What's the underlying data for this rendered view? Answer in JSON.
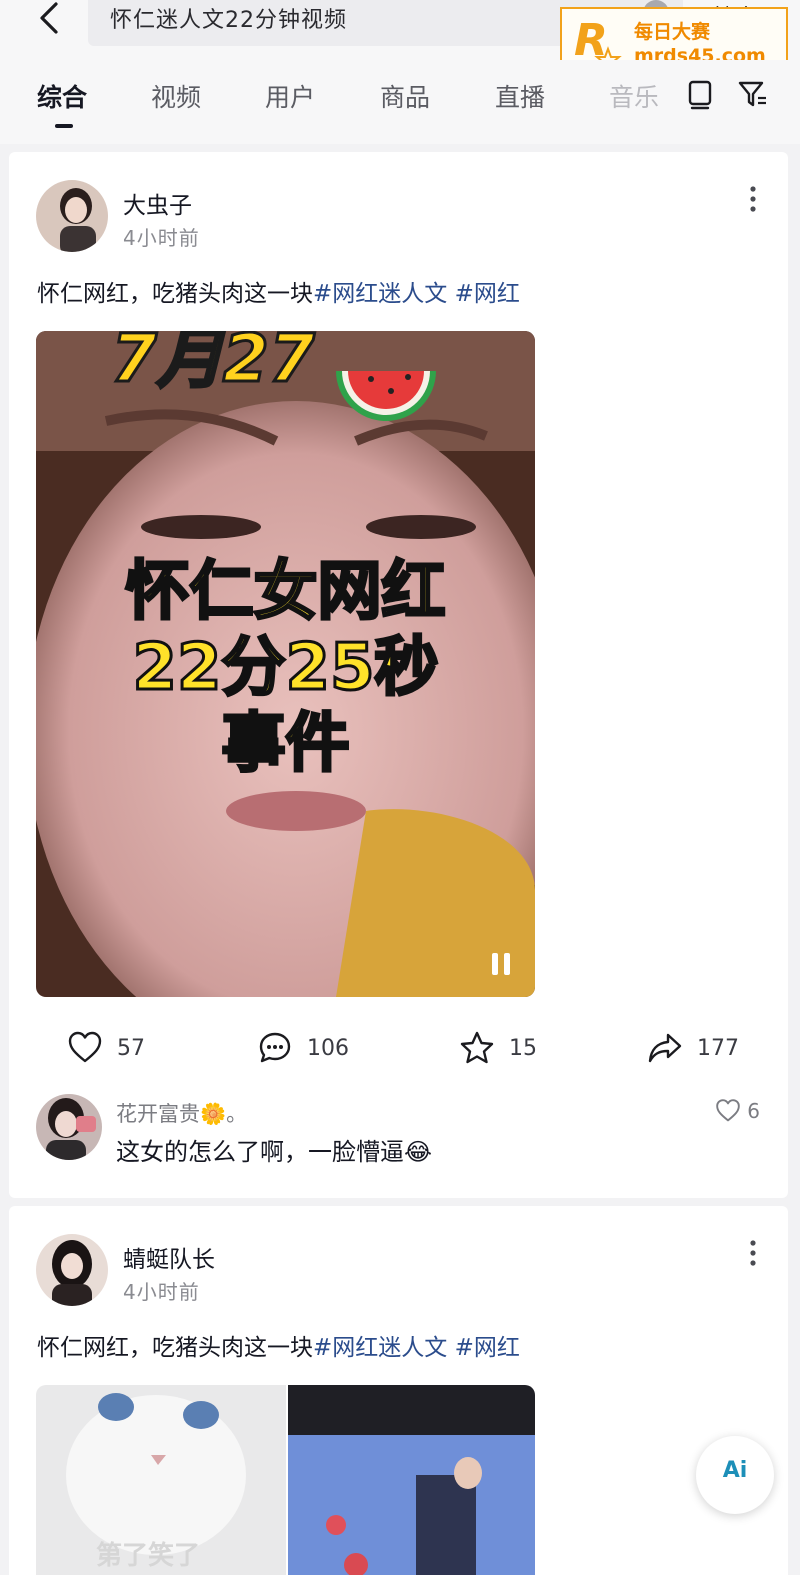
{
  "search": {
    "query": "怀仁迷人文22分钟视频",
    "clear_icon": "close-circle-icon",
    "submit_label": "搜索"
  },
  "watermark": {
    "title": "每日大赛",
    "url": "mrds45.com",
    "color": "#f08a00"
  },
  "tabs": [
    {
      "label": "综合",
      "active": true
    },
    {
      "label": "视频",
      "active": false
    },
    {
      "label": "用户",
      "active": false
    },
    {
      "label": "商品",
      "active": false
    },
    {
      "label": "直播",
      "active": false
    },
    {
      "label": "音乐",
      "active": false
    }
  ],
  "posts": [
    {
      "author": "大虫子",
      "time": "4小时前",
      "caption_text": "怀仁网红，吃猪头肉这一块",
      "tags": [
        "#网红迷人文",
        "#网红"
      ],
      "video": {
        "date_overlay": "7月27",
        "title_lines": [
          "怀仁女网红",
          "22分25秒",
          "事件"
        ]
      },
      "stats": {
        "likes": "57",
        "comments": "106",
        "favorites": "15",
        "shares": "177"
      },
      "top_comment": {
        "user": "花开富贵🌼。",
        "text": "这女的怎么了啊，一脸懵逼😂",
        "likes": "6"
      }
    },
    {
      "author": "蜻蜓队长",
      "time": "4小时前",
      "caption_text": "怀仁网红，吃猪头肉这一块",
      "tags": [
        "#网红迷人文",
        "#网红"
      ],
      "thumb_text": "第了笑了"
    }
  ],
  "ai_button": {
    "label": "Ai"
  },
  "colors": {
    "tag": "#2b4c8c",
    "overlay_text": "#ffe22a",
    "background": "#f2f2f4"
  }
}
